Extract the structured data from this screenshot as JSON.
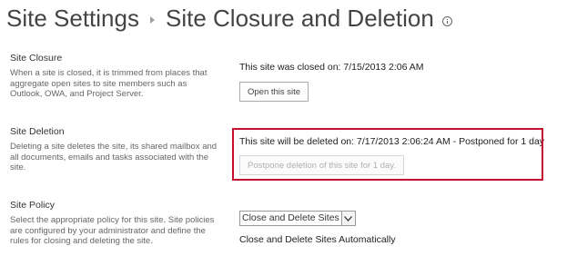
{
  "header": {
    "parent_crumb": "Site Settings",
    "title": "Site Closure and Deletion"
  },
  "closure": {
    "title": "Site Closure",
    "description": "When a site is closed, it is trimmed from places that aggregate open sites to site members such as Outlook, OWA, and Project Server.",
    "status": "This site was closed on: 7/15/2013 2:06 AM",
    "button_label": "Open this site"
  },
  "deletion": {
    "title": "Site Deletion",
    "description": "Deleting a site deletes the site, its shared mailbox and all documents, emails and tasks associated with the site.",
    "status": "This site will be deleted on: 7/17/2013 2:06:24 AM - Postponed for 1 day",
    "button_label": "Postpone deletion of this site for 1 day.",
    "highlight_color": "#c8102e"
  },
  "policy": {
    "title": "Site Policy",
    "description": "Select the appropriate policy for this site. Site policies are configured by your administrator and define the rules for closing and deleting the site.",
    "selected": "Close and Delete Sites",
    "policy_description": "Close and Delete Sites Automatically"
  },
  "icons": {
    "info": "info-icon",
    "breadcrumb_separator": "chevron-right-icon",
    "dropdown_arrow": "chevron-down-icon"
  }
}
